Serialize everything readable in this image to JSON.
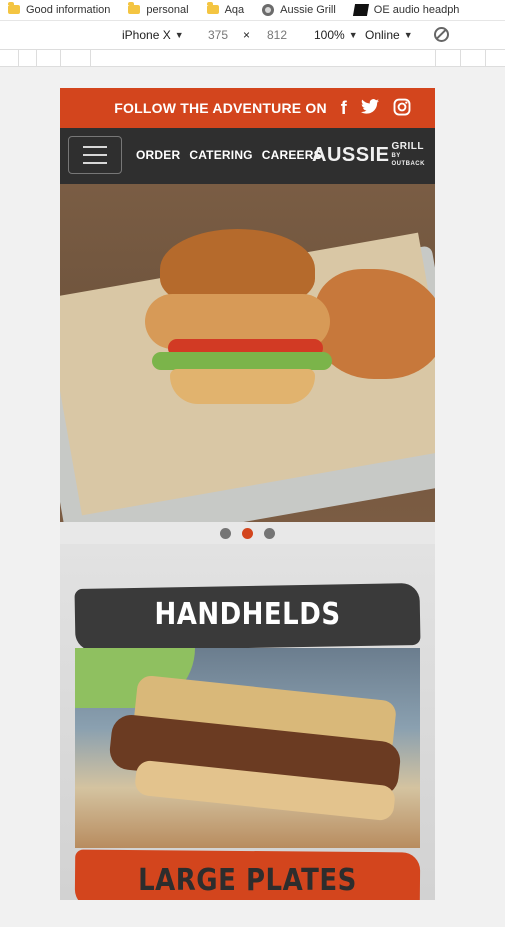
{
  "browser": {
    "bookmarks": [
      {
        "label": "Good information",
        "icon": "folder-icon"
      },
      {
        "label": "personal",
        "icon": "folder-icon"
      },
      {
        "label": "Aqa",
        "icon": "folder-icon"
      },
      {
        "label": "Aussie Grill",
        "icon": "globe-icon"
      },
      {
        "label": "OE audio headph",
        "icon": "brand-icon"
      }
    ],
    "device": {
      "model": "iPhone X",
      "width": "375",
      "times": "×",
      "height": "812",
      "zoom": "100%",
      "network": "Online"
    }
  },
  "site": {
    "follow_text": "FOLLOW THE ADVENTURE ON",
    "social": [
      "facebook-icon",
      "twitter-icon",
      "instagram-icon"
    ],
    "nav": [
      "ORDER",
      "CATERING",
      "CAREERS"
    ],
    "logo": {
      "main": "AUSSIE",
      "sub": "GRILL",
      "tag": "BY OUTBACK"
    },
    "carousel": {
      "slides": 3,
      "active": 1
    },
    "sections": [
      {
        "title": "HANDHELDS"
      },
      {
        "title": "LARGE PLATES"
      }
    ]
  }
}
